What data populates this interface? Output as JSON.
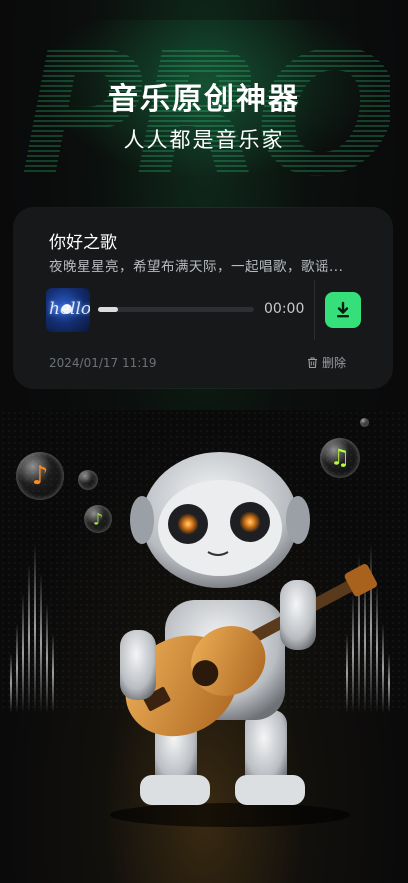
{
  "hero": {
    "watermark": "PRO",
    "title": "音乐原创神器",
    "subtitle": "人人都是音乐家"
  },
  "song_card": {
    "title": "你好之歌",
    "lyrics": "夜晚星星亮，希望布满天际，一起唱歌，歌谣...",
    "cover_text": "hello",
    "progress": 0.13,
    "time": "00:00",
    "date": "2024/01/17 11:19",
    "delete_label": "删除"
  },
  "colors": {
    "accent_green": "#35e07a",
    "card_bg": "#16181a"
  },
  "icons": {
    "download": "download-icon",
    "delete": "trash-icon",
    "notes": "music-note-icon"
  }
}
